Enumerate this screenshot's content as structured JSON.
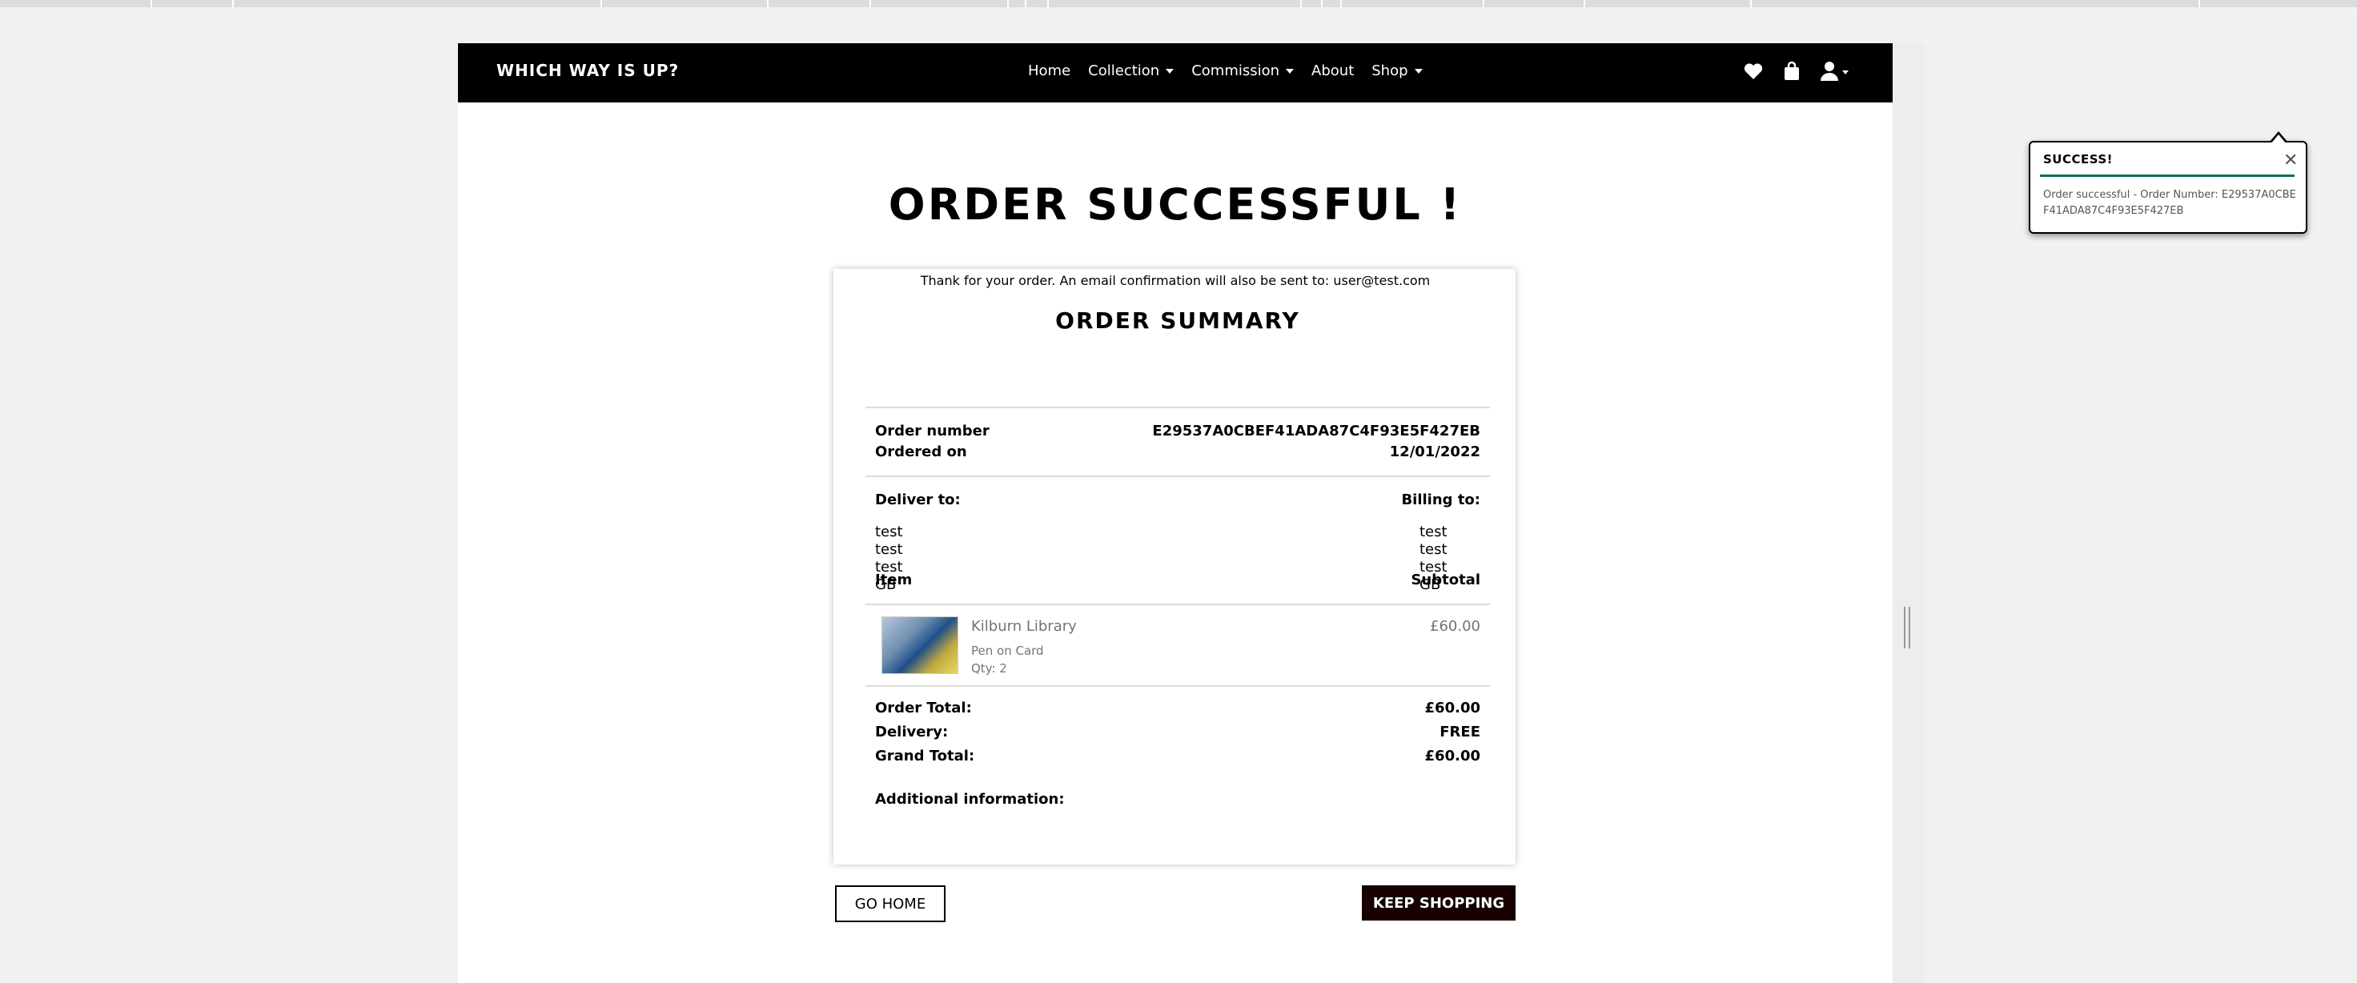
{
  "navbar": {
    "brand": "WHICH WAY IS UP?",
    "links": [
      {
        "label": "Home",
        "dropdown": false
      },
      {
        "label": "Collection",
        "dropdown": true
      },
      {
        "label": "Commission",
        "dropdown": true
      },
      {
        "label": "About",
        "dropdown": false
      },
      {
        "label": "Shop",
        "dropdown": true
      }
    ],
    "icons": [
      "heart-icon",
      "shopping-bag-icon",
      "user-icon"
    ]
  },
  "toast": {
    "title": "SUCCESS!",
    "message": "Order successful - Order Number: E29537A0CBEF41ADA87C4F93E5F427EB",
    "accent": "#0b6b5e"
  },
  "page": {
    "title": "ORDER SUCCESSFUL !",
    "thanks": "Thank for your order. An email confirmation will also be sent to: user@test.com"
  },
  "summary": {
    "title": "ORDER SUMMARY",
    "order_number_label": "Order number",
    "order_number": "E29537A0CBEF41ADA87C4F93E5F427EB",
    "ordered_on_label": "Ordered on",
    "ordered_on": "12/01/2022",
    "deliver_label": "Deliver to:",
    "billing_label": "Billing to:",
    "deliver_lines": [
      "test",
      "test",
      "test",
      "GB"
    ],
    "billing_lines": [
      "test",
      "test",
      "test",
      "GB"
    ],
    "item_label": "Item",
    "subtotal_label": "Subtotal",
    "item": {
      "name": "Kilburn Library",
      "medium": "Pen on Card",
      "qty": "Qty: 2",
      "price": "£60.00"
    },
    "order_total_label": "Order Total:",
    "order_total": "£60.00",
    "delivery_label": "Delivery:",
    "delivery": "FREE",
    "grand_total_label": "Grand Total:",
    "grand_total": "£60.00",
    "additional_label": "Additional information:"
  },
  "buttons": {
    "go_home": "GO HOME",
    "keep_shopping": "KEEP SHOPPING"
  }
}
